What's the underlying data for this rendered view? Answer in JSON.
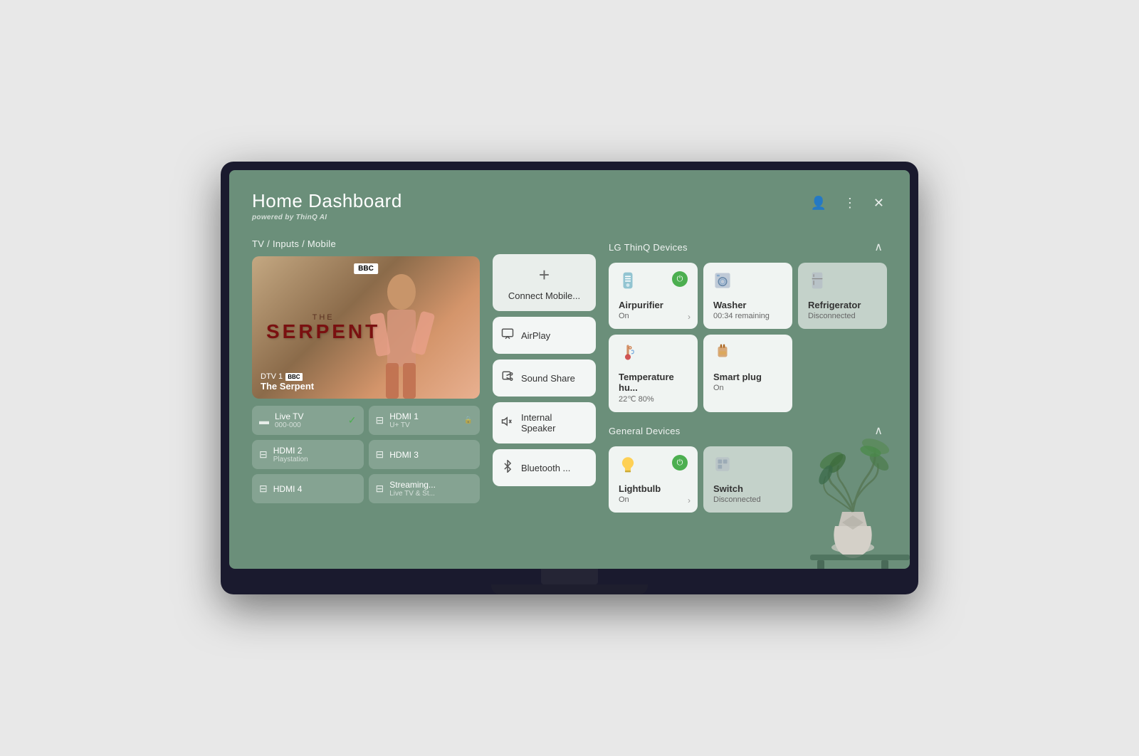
{
  "header": {
    "title": "Home Dashboard",
    "powered_by_prefix": "powered by",
    "powered_by_brand": "ThinQ AI"
  },
  "tv_inputs_section": {
    "label": "TV / Inputs / Mobile",
    "channel": "DTV 1",
    "channel_name": "BBC",
    "show_the": "THE",
    "show_name": "SERPENT",
    "show_title_display": "The Serpent",
    "inputs": [
      {
        "name": "Live TV",
        "sub": "000-000",
        "active": true,
        "locked": false
      },
      {
        "name": "HDMI 1",
        "sub": "U+ TV",
        "active": false,
        "locked": true
      },
      {
        "name": "HDMI 2",
        "sub": "Playstation",
        "active": false,
        "locked": false
      },
      {
        "name": "HDMI 3",
        "sub": "",
        "active": false,
        "locked": false
      },
      {
        "name": "HDMI 4",
        "sub": "",
        "active": false,
        "locked": false
      },
      {
        "name": "Streaming...",
        "sub": "Live TV & St...",
        "active": false,
        "locked": false
      }
    ]
  },
  "mobile_actions": [
    {
      "id": "connect-mobile",
      "label": "Connect Mobile...",
      "icon": "+"
    },
    {
      "id": "airplay",
      "label": "AirPlay",
      "icon": "▷□"
    },
    {
      "id": "sound-share",
      "label": "Sound Share",
      "icon": "🔊"
    },
    {
      "id": "internal-speaker",
      "label": "Internal Speaker",
      "icon": "🔈"
    },
    {
      "id": "bluetooth",
      "label": "Bluetooth ...",
      "icon": "⚡"
    }
  ],
  "thinq_section": {
    "label": "LG ThinQ Devices",
    "devices": [
      {
        "id": "airpurifier",
        "name": "Airpurifier",
        "status": "On",
        "powered": true,
        "disconnected": false,
        "icon": "💨"
      },
      {
        "id": "washer",
        "name": "Washer",
        "status": "00:34 remaining",
        "powered": false,
        "disconnected": false,
        "icon": "🫧"
      },
      {
        "id": "refrigerator",
        "name": "Refrigerator",
        "status": "Disconnected",
        "powered": false,
        "disconnected": true,
        "icon": "🧊"
      },
      {
        "id": "temperature",
        "name": "Temperature hu...",
        "status": "22℃ 80%",
        "powered": false,
        "disconnected": false,
        "icon": "🌡️"
      },
      {
        "id": "smartplug",
        "name": "Smart plug",
        "status": "On",
        "powered": false,
        "disconnected": false,
        "icon": "🔌"
      }
    ]
  },
  "general_section": {
    "label": "General Devices",
    "devices": [
      {
        "id": "lightbulb",
        "name": "Lightbulb",
        "status": "On",
        "powered": true,
        "disconnected": false,
        "icon": "💡"
      },
      {
        "id": "switch",
        "name": "Switch",
        "status": "Disconnected",
        "powered": false,
        "disconnected": true,
        "icon": "🔲"
      }
    ]
  },
  "icons": {
    "user": "👤",
    "more": "⋮",
    "close": "✕",
    "collapse": "∧",
    "chevron_right": "›",
    "check_circle": "✓",
    "power": "⏻",
    "tv": "▬",
    "hdmi": "⊟"
  }
}
